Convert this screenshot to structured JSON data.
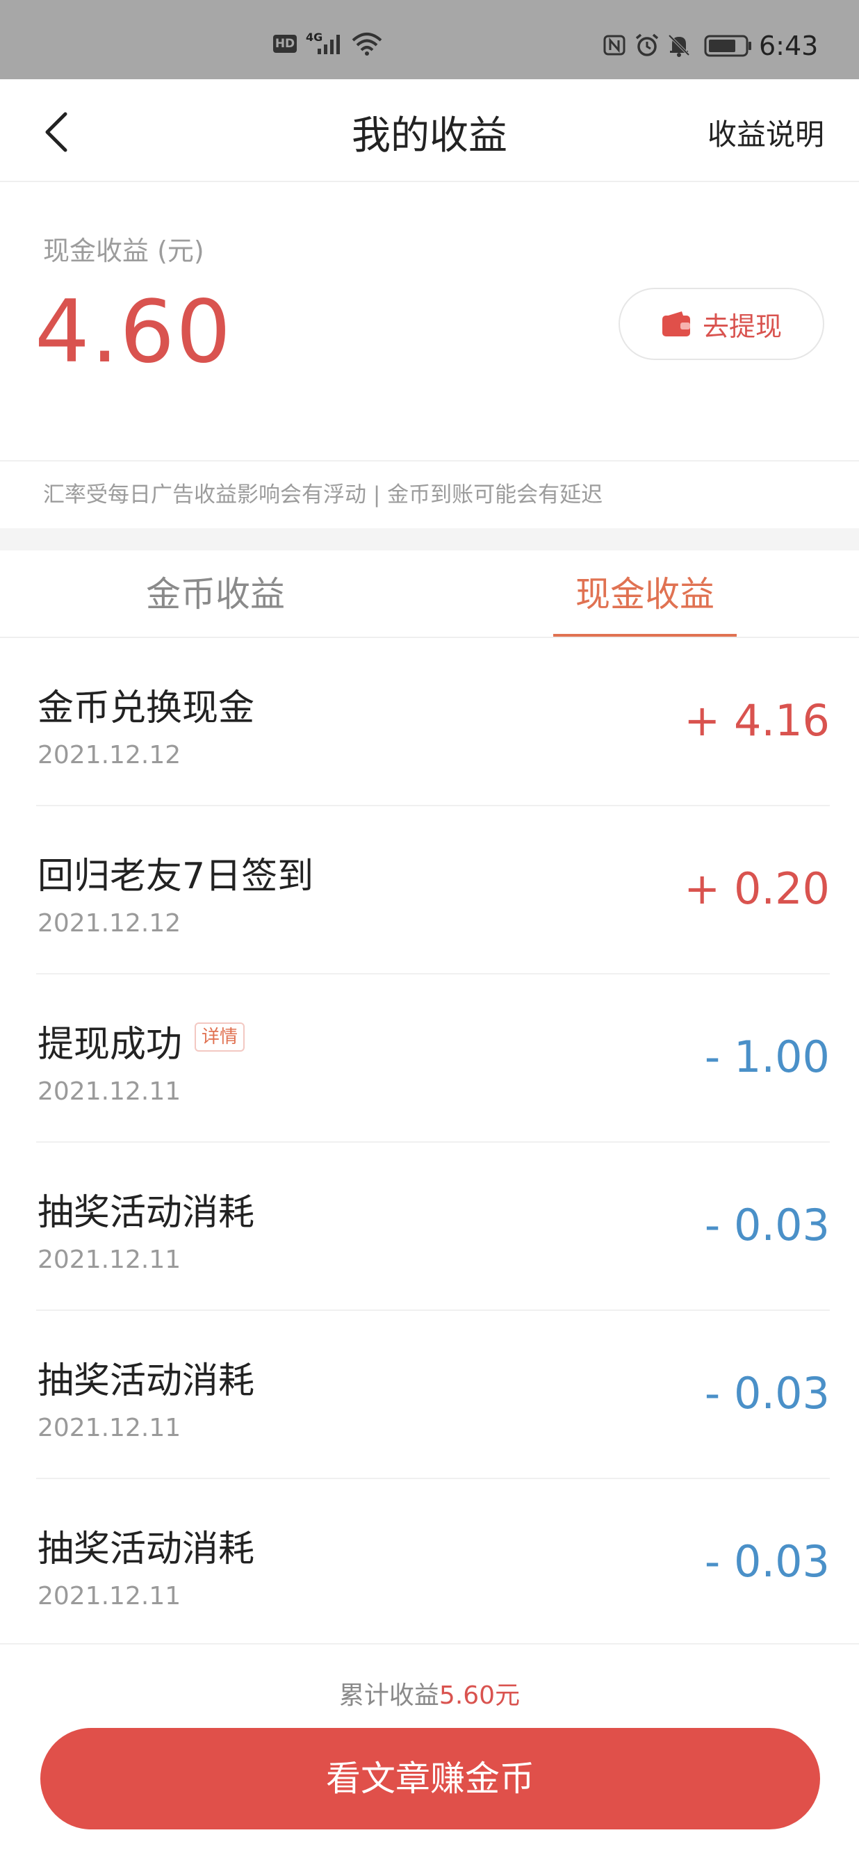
{
  "status_bar": {
    "hd": "HD",
    "network": "4G",
    "time": "6:43",
    "icons": [
      "signal-icon",
      "wifi-icon",
      "nfc-icon",
      "alarm-icon",
      "bell-muted-icon",
      "battery-icon"
    ]
  },
  "nav": {
    "back_icon": "chevron-left-icon",
    "title": "我的收益",
    "right_link": "收益说明"
  },
  "balance": {
    "label": "现金收益 (元)",
    "amount": "4.60",
    "withdraw_label": "去提现",
    "withdraw_icon": "wallet-icon"
  },
  "notice": "汇率受每日广告收益影响会有浮动 | 金币到账可能会有延迟",
  "tabs": [
    {
      "label": "金币收益",
      "active": false
    },
    {
      "label": "现金收益",
      "active": true
    }
  ],
  "records": [
    {
      "title": "金币兑换现金",
      "date": "2021.12.12",
      "amount": "+ 4.16",
      "sign": "positive"
    },
    {
      "title": "回归老友7日签到",
      "date": "2021.12.12",
      "amount": "+ 0.20",
      "sign": "positive"
    },
    {
      "title": "提现成功",
      "badge": "详情",
      "date": "2021.12.11",
      "amount": "- 1.00",
      "sign": "negative"
    },
    {
      "title": "抽奖活动消耗",
      "date": "2021.12.11",
      "amount": "- 0.03",
      "sign": "negative"
    },
    {
      "title": "抽奖活动消耗",
      "date": "2021.12.11",
      "amount": "- 0.03",
      "sign": "negative"
    },
    {
      "title": "抽奖活动消耗",
      "date": "2021.12.11",
      "amount": "- 0.03",
      "sign": "negative"
    }
  ],
  "footer": {
    "total_label": "累计收益",
    "total_value": "5.60元",
    "cta_label": "看文章赚金币"
  },
  "colors": {
    "accent_red": "#d9534f",
    "tab_active": "#e07252",
    "negative_blue": "#4a90c8",
    "cta_bg": "#e0504a"
  }
}
